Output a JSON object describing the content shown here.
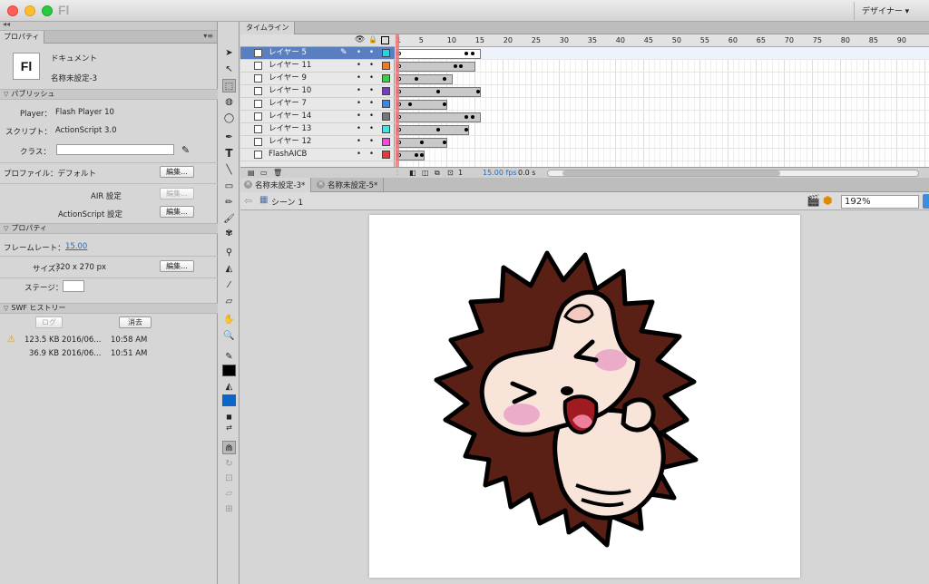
{
  "titlebar": {
    "app_mark": "Fl",
    "workspace": "デザイナー ▾"
  },
  "properties": {
    "tab": "プロパティ",
    "panel_menu": "▾≡",
    "doc_icon": "Fl",
    "doc_type": "ドキュメント",
    "doc_name": "名称未設定-3",
    "publish_section": "パブリッシュ",
    "player_label": "Player：",
    "player_value": "Flash Player 10",
    "script_label": "スクリプト：",
    "script_value": "ActionScript 3.0",
    "class_label": "クラス：",
    "profile_label": "プロファイル：デフォルト",
    "edit_btn": "編集...",
    "air_label": "AIR 設定",
    "as_label": "ActionScript 設定",
    "props_section": "プロパティ",
    "framerate_label": "フレームレート：",
    "framerate_value": "15.00",
    "size_label": "サイズ：",
    "size_value": "320 x 270 px",
    "stage_label": "ステージ：",
    "stage_color": "#ffffff",
    "swf_section": "SWF ヒストリー",
    "log_btn": "ログ",
    "clear_btn": "消去",
    "history": [
      {
        "size": "123.5 KB",
        "date": "2016/06...",
        "time": "10:58 AM",
        "warn": "⚠"
      },
      {
        "size": "36.9 KB",
        "date": "2016/06...",
        "time": "10:51 AM",
        "warn": ""
      }
    ]
  },
  "tools": {
    "fill_color": "#0a66c8",
    "stroke_color": "#000000"
  },
  "timeline": {
    "tab": "タイムライン",
    "ruler": [
      "1",
      "5",
      "10",
      "15",
      "20",
      "25",
      "30",
      "35",
      "40",
      "45",
      "50",
      "55",
      "60",
      "65",
      "70",
      "75",
      "80",
      "85",
      "90"
    ],
    "layers": [
      {
        "name": "レイヤー 5",
        "color": "#29d3e6",
        "active": true
      },
      {
        "name": "レイヤー 11",
        "color": "#f07a1e"
      },
      {
        "name": "レイヤー 9",
        "color": "#3bd046"
      },
      {
        "name": "レイヤー 10",
        "color": "#7a3bc2"
      },
      {
        "name": "レイヤー 7",
        "color": "#3a86e0"
      },
      {
        "name": "レイヤー 14",
        "color": "#777777"
      },
      {
        "name": "レイヤー 13",
        "color": "#3de6e6"
      },
      {
        "name": "レイヤー 12",
        "color": "#f04adb"
      },
      {
        "name": "FlashAICB",
        "color": "#e33a3a"
      }
    ],
    "footer_frame": "1",
    "footer_fps": "15.00 fps",
    "footer_time": "0.0 s"
  },
  "doc_tabs": [
    "名称未設定-3*",
    "名称未設定-5*"
  ],
  "editbar": {
    "scene": "シーン 1",
    "zoom": "192%"
  }
}
